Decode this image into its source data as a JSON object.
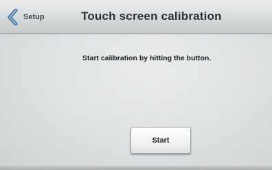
{
  "header": {
    "back_label": "Setup",
    "back_icon": "chevron-left-icon",
    "title": "Touch screen calibration"
  },
  "content": {
    "instruction": "Start calibration by hitting the button.",
    "start_label": "Start"
  },
  "colors": {
    "background": "#e3e6e6",
    "header": "#d7dadb",
    "icon_accent": "#4f7fa8",
    "text": "#1d2022"
  }
}
